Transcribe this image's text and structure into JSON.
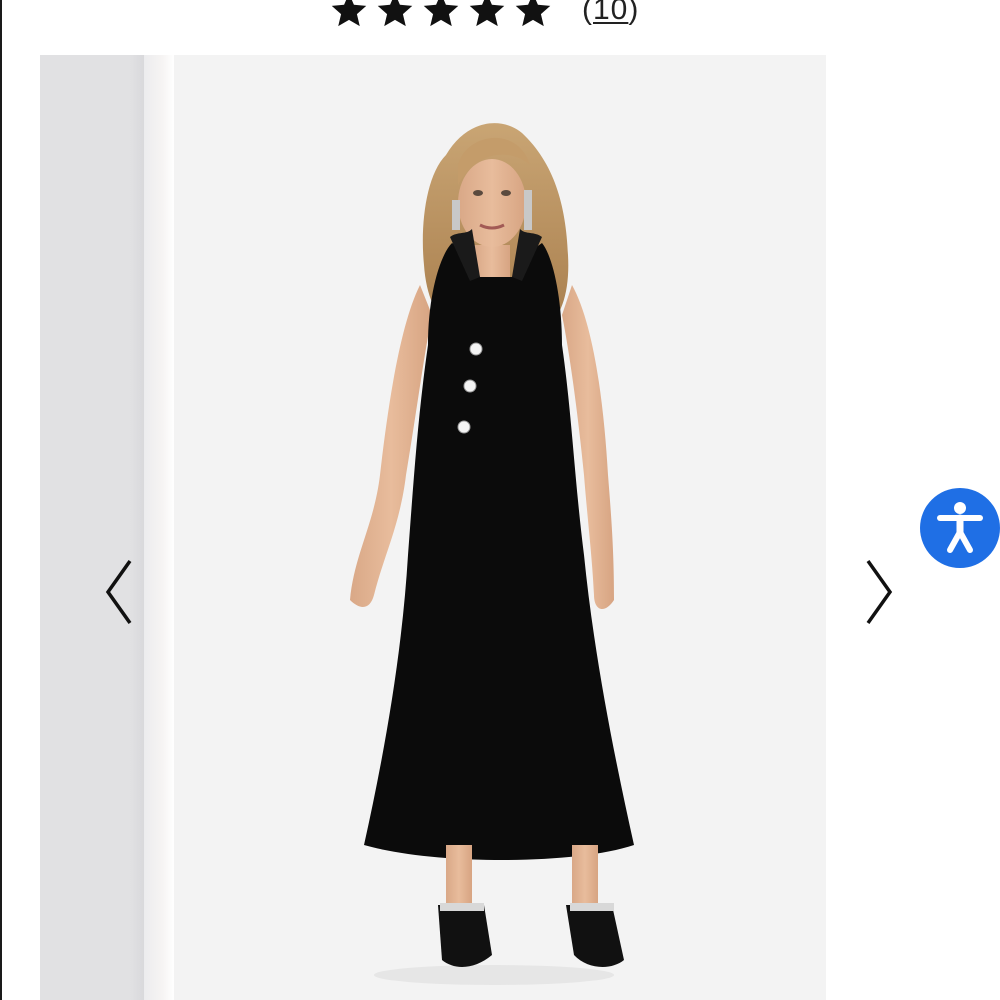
{
  "rating": {
    "stars_filled": 5,
    "stars_total": 5,
    "review_count": "10",
    "open_paren": "(",
    "close_paren": ")"
  },
  "carousel": {
    "prev_icon": "chevron-left-icon",
    "next_icon": "chevron-right-icon",
    "slide_description_icon": "product-photo"
  },
  "accessibility": {
    "icon": "accessibility-person-icon",
    "color": "#1f6fe5"
  },
  "colors": {
    "star": "#111111",
    "photo_background": "#f3f3f3",
    "dress": "#0b0b0b"
  }
}
